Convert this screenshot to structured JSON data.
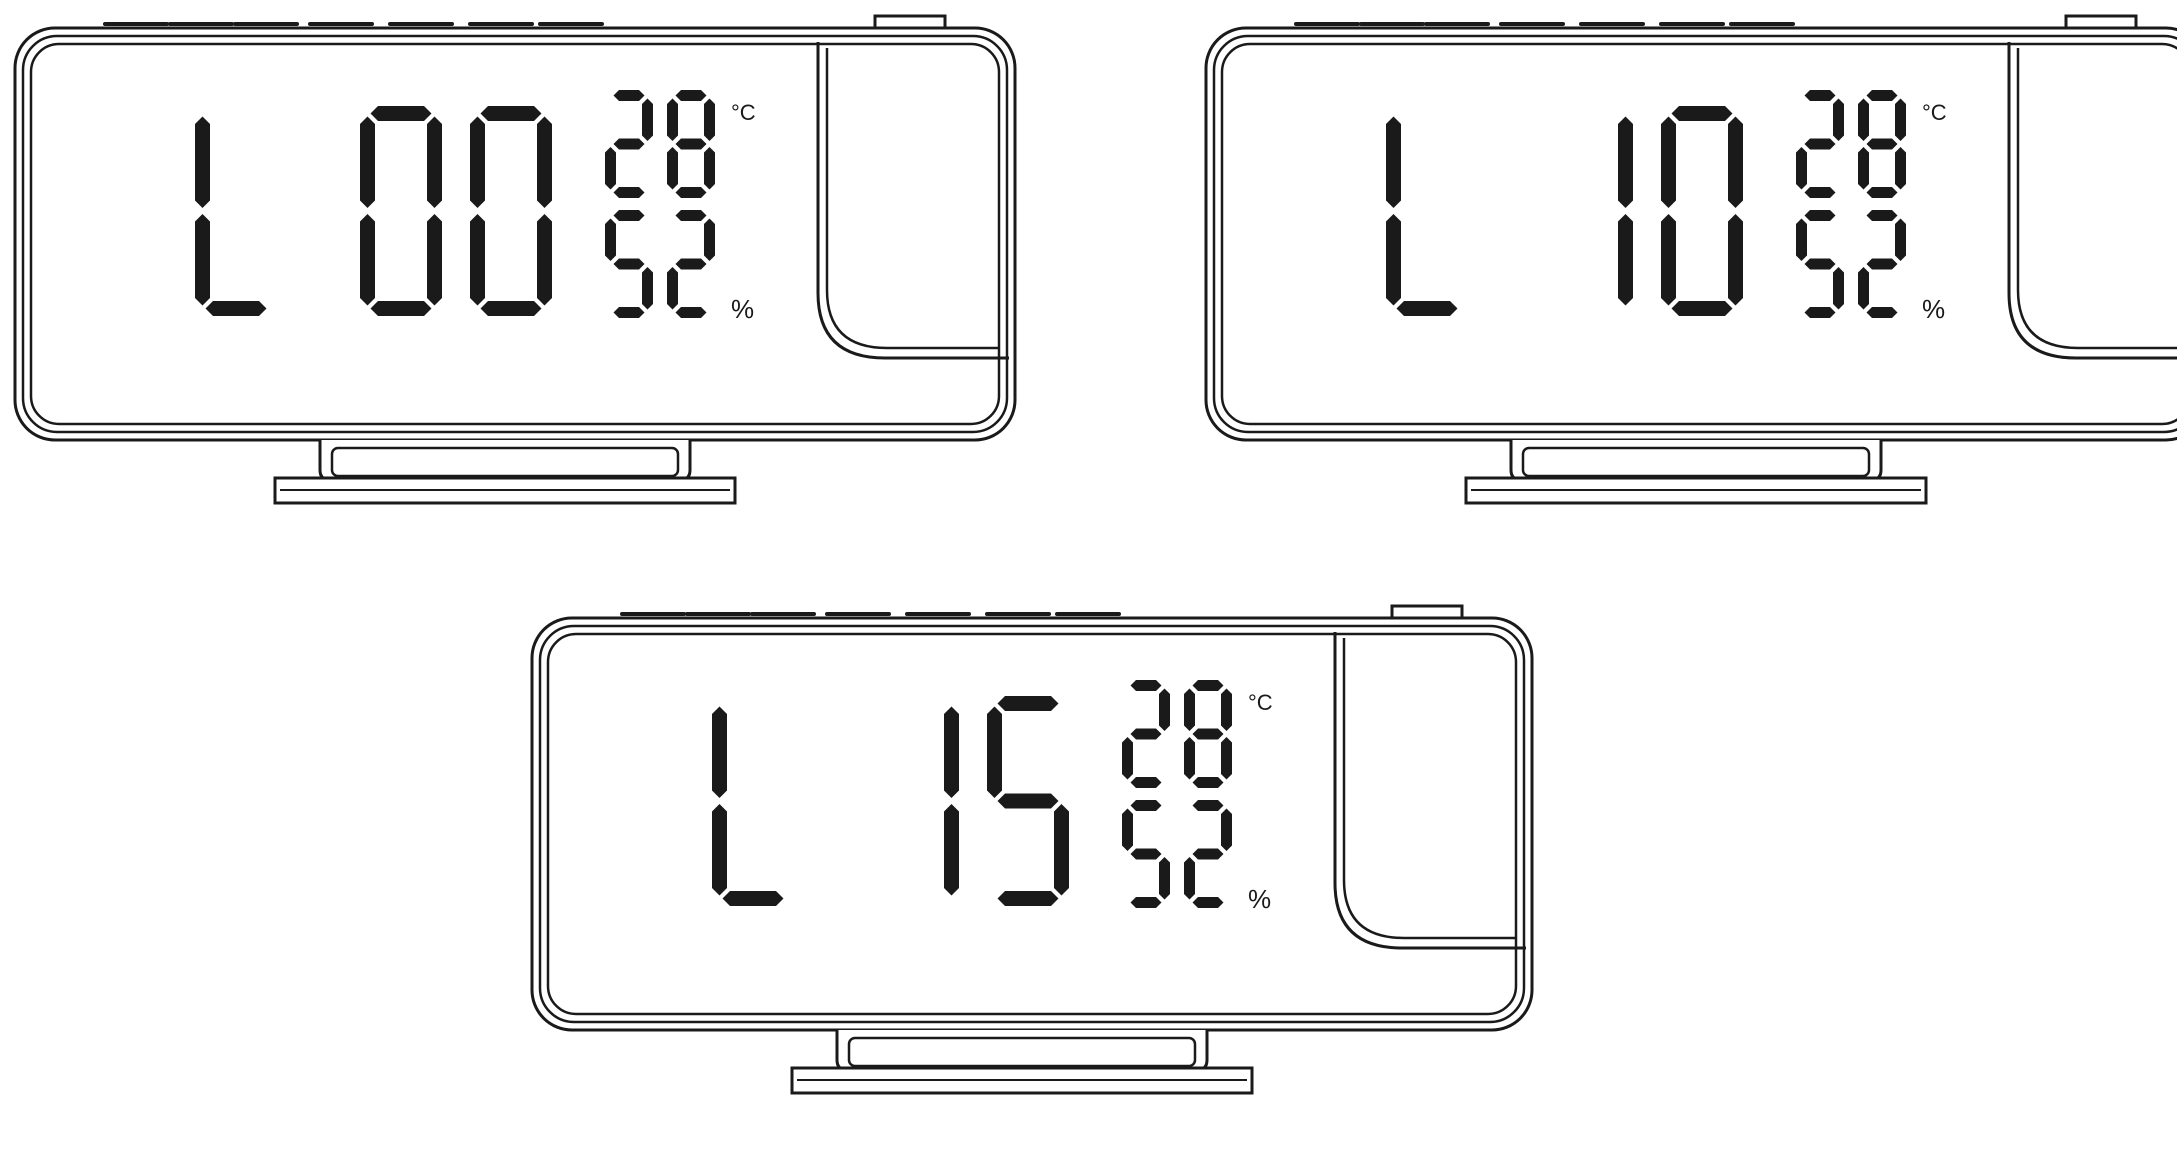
{
  "colors": {
    "ink": "#1a1a1a",
    "paper": "#ffffff"
  },
  "units": {
    "temperature_unit": "°C",
    "humidity_unit": "%"
  },
  "clocks": [
    {
      "id": "clock-l00",
      "mode": "L",
      "value": "00",
      "temperature": "28",
      "humidity": "52",
      "cropped_right": false
    },
    {
      "id": "clock-l10",
      "mode": "L",
      "value": "10",
      "temperature": "28",
      "humidity": "52",
      "cropped_right": true
    },
    {
      "id": "clock-l15",
      "mode": "L",
      "value": "15",
      "temperature": "28",
      "humidity": "52",
      "cropped_right": false
    }
  ]
}
